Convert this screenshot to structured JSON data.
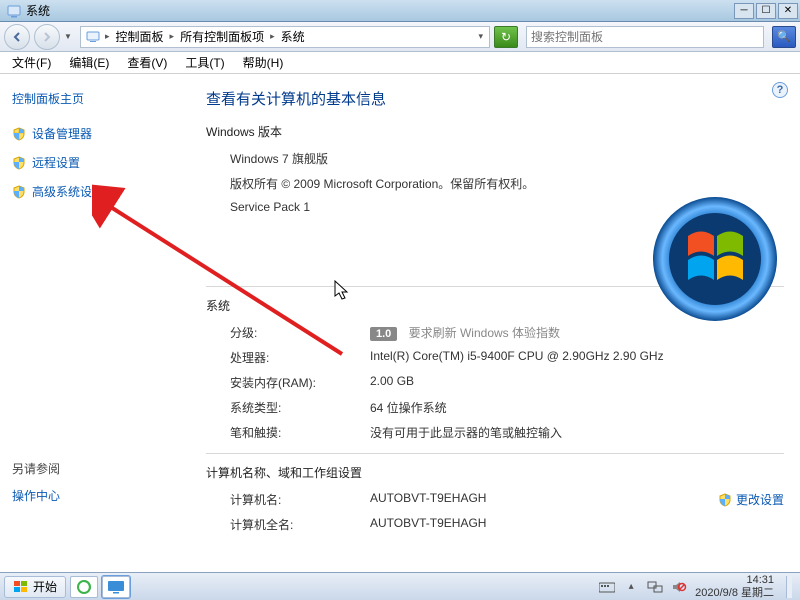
{
  "window": {
    "title": "系统"
  },
  "nav": {
    "breadcrumb": [
      "控制面板",
      "所有控制面板项",
      "系统"
    ],
    "search_placeholder": "搜索控制面板"
  },
  "menu": [
    "文件(F)",
    "编辑(E)",
    "查看(V)",
    "工具(T)",
    "帮助(H)"
  ],
  "sidebar": {
    "home": "控制面板主页",
    "items": [
      "设备管理器",
      "远程设置",
      "高级系统设置"
    ],
    "see_also_label": "另请参阅",
    "see_also": [
      "操作中心"
    ]
  },
  "main": {
    "heading": "查看有关计算机的基本信息",
    "edition_heading": "Windows 版本",
    "edition_lines": [
      "Windows 7 旗舰版",
      "版权所有 © 2009 Microsoft Corporation。保留所有权利。",
      "Service Pack 1"
    ],
    "system_heading": "系统",
    "rating": {
      "label": "分级:",
      "badge": "1.0",
      "text": "要求刷新 Windows 体验指数"
    },
    "rows": [
      {
        "k": "处理器:",
        "v": "Intel(R) Core(TM) i5-9400F CPU @ 2.90GHz   2.90 GHz"
      },
      {
        "k": "安装内存(RAM):",
        "v": "2.00 GB"
      },
      {
        "k": "系统类型:",
        "v": "64 位操作系统"
      },
      {
        "k": "笔和触摸:",
        "v": "没有可用于此显示器的笔或触控输入"
      }
    ],
    "netid_heading": "计算机名称、域和工作组设置",
    "netid_rows": [
      {
        "k": "计算机名:",
        "v": "AUTOBVT-T9EHAGH"
      },
      {
        "k": "计算机全名:",
        "v": "AUTOBVT-T9EHAGH"
      }
    ],
    "change_settings": "更改设置"
  },
  "taskbar": {
    "start": "开始",
    "clock_time": "14:31",
    "clock_date": "2020/9/8 星期二"
  }
}
